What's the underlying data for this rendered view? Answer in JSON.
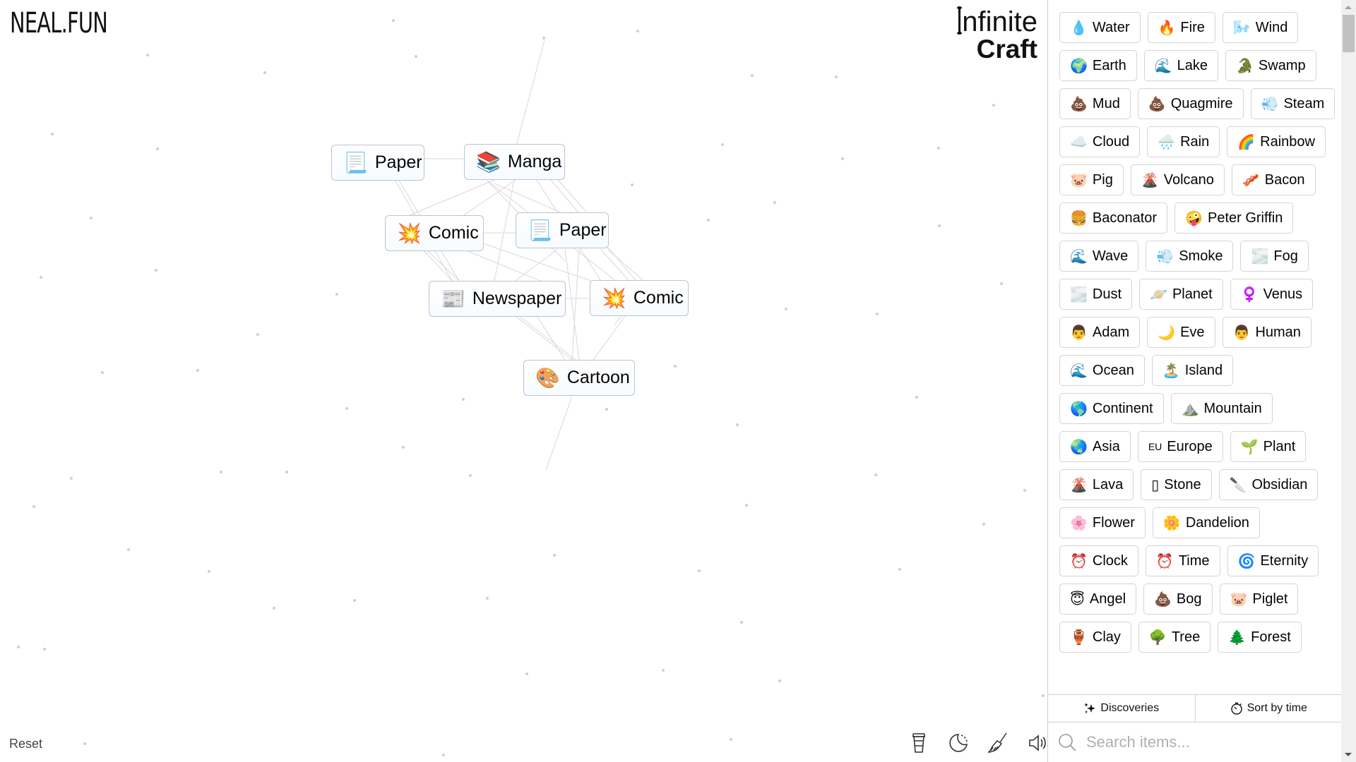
{
  "header": {
    "logo": "NEAL.FUN",
    "title_line1": "nfinite",
    "title_line2": "Craft"
  },
  "canvas": {
    "nodes": [
      {
        "label": "Paper",
        "emoji": "📃",
        "icon": "page-curl-icon"
      },
      {
        "label": "Manga",
        "emoji": "📚",
        "icon": "books-icon"
      },
      {
        "label": "Comic",
        "emoji": "💥",
        "icon": "collision-icon"
      },
      {
        "label": "Paper",
        "emoji": "📃",
        "icon": "page-curl-icon"
      },
      {
        "label": "Newspaper",
        "emoji": "📰",
        "icon": "newspaper-icon"
      },
      {
        "label": "Comic",
        "emoji": "💥",
        "icon": "collision-icon"
      },
      {
        "label": "Cartoon",
        "emoji": "🎨",
        "icon": "palette-icon"
      }
    ],
    "reset_label": "Reset",
    "tools": [
      {
        "name": "coffee-icon",
        "label": "Support"
      },
      {
        "name": "dark-mode-icon",
        "label": "Dark mode"
      },
      {
        "name": "broom-icon",
        "label": "Clear"
      },
      {
        "name": "sound-icon",
        "label": "Sound"
      }
    ]
  },
  "sidebar": {
    "items": [
      {
        "label": "Water",
        "emoji": "💧"
      },
      {
        "label": "Fire",
        "emoji": "🔥"
      },
      {
        "label": "Wind",
        "emoji": "🌬️"
      },
      {
        "label": "Earth",
        "emoji": "🌍"
      },
      {
        "label": "Lake",
        "emoji": "🌊"
      },
      {
        "label": "Swamp",
        "emoji": "🐊"
      },
      {
        "label": "Mud",
        "emoji": "💩"
      },
      {
        "label": "Quagmire",
        "emoji": "💩"
      },
      {
        "label": "Steam",
        "emoji": "💨"
      },
      {
        "label": "Cloud",
        "emoji": "☁️"
      },
      {
        "label": "Rain",
        "emoji": "🌧️"
      },
      {
        "label": "Rainbow",
        "emoji": "🌈"
      },
      {
        "label": "Pig",
        "emoji": "🐷"
      },
      {
        "label": "Volcano",
        "emoji": "🌋"
      },
      {
        "label": "Bacon",
        "emoji": "🥓"
      },
      {
        "label": "Baconator",
        "emoji": "🍔"
      },
      {
        "label": "Peter Griffin",
        "emoji": "🤪"
      },
      {
        "label": "Wave",
        "emoji": "🌊"
      },
      {
        "label": "Smoke",
        "emoji": "💨"
      },
      {
        "label": "Fog",
        "emoji": "🌫️"
      },
      {
        "label": "Dust",
        "emoji": "🌫️"
      },
      {
        "label": "Planet",
        "emoji": "🪐"
      },
      {
        "label": "Venus",
        "emoji": "♀️"
      },
      {
        "label": "Adam",
        "emoji": "👨"
      },
      {
        "label": "Eve",
        "emoji": "🌙"
      },
      {
        "label": "Human",
        "emoji": "👨"
      },
      {
        "label": "Ocean",
        "emoji": "🌊"
      },
      {
        "label": "Island",
        "emoji": "🏝️"
      },
      {
        "label": "Continent",
        "emoji": "🌎"
      },
      {
        "label": "Mountain",
        "emoji": "⛰️"
      },
      {
        "label": "Asia",
        "emoji": "🌏"
      },
      {
        "label": "Europe",
        "emoji": "EU"
      },
      {
        "label": "Plant",
        "emoji": "🌱"
      },
      {
        "label": "Lava",
        "emoji": "🌋"
      },
      {
        "label": "Stone",
        "emoji": "▯"
      },
      {
        "label": "Obsidian",
        "emoji": "🔪"
      },
      {
        "label": "Flower",
        "emoji": "🌸"
      },
      {
        "label": "Dandelion",
        "emoji": "🌼"
      },
      {
        "label": "Clock",
        "emoji": "⏰"
      },
      {
        "label": "Time",
        "emoji": "⏰"
      },
      {
        "label": "Eternity",
        "emoji": "🌀"
      },
      {
        "label": "Angel",
        "emoji": "😇"
      },
      {
        "label": "Bog",
        "emoji": "💩"
      },
      {
        "label": "Piglet",
        "emoji": "🐷"
      },
      {
        "label": "Clay",
        "emoji": "🏺"
      },
      {
        "label": "Tree",
        "emoji": "🌳"
      },
      {
        "label": "Forest",
        "emoji": "🌲"
      }
    ],
    "tabs": {
      "discoveries": "Discoveries",
      "sort": "Sort by time"
    },
    "search": {
      "placeholder": "Search items...",
      "value": ""
    }
  }
}
